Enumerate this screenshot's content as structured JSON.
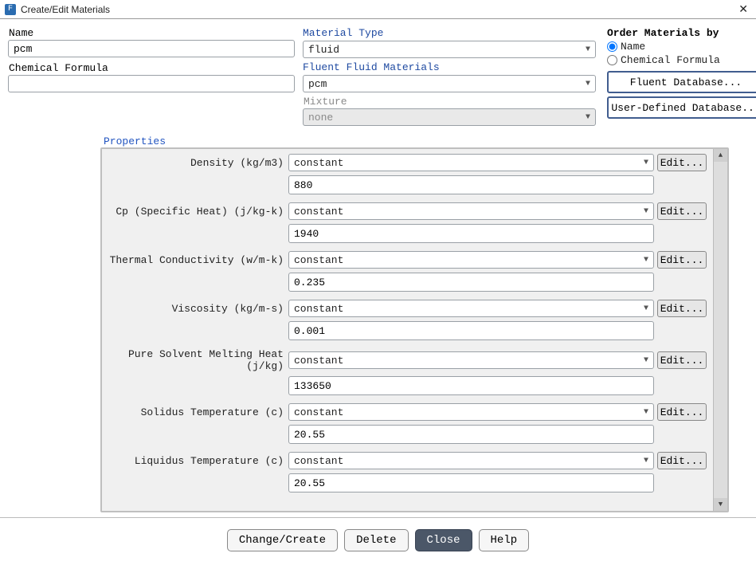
{
  "window": {
    "icon_text": "F",
    "title": "Create/Edit Materials",
    "close": "✕"
  },
  "col1": {
    "name_label": "Name",
    "name_value": "pcm",
    "formula_label": "Chemical Formula",
    "formula_value": ""
  },
  "col2": {
    "type_label": "Material Type",
    "type_value": "fluid",
    "ffm_label": "Fluent Fluid Materials",
    "ffm_value": "pcm",
    "mix_label": "Mixture",
    "mix_value": "none"
  },
  "col3": {
    "order_label": "Order Materials by",
    "radio_name": "Name",
    "radio_formula": "Chemical Formula",
    "btn_fluent_db": "Fluent Database...",
    "btn_user_db": "User-Defined Database..."
  },
  "properties_heading": "Properties",
  "props": [
    {
      "label": "Density (kg/m3)",
      "method": "constant",
      "value": "880"
    },
    {
      "label": "Cp (Specific Heat) (j/kg-k)",
      "method": "constant",
      "value": "1940"
    },
    {
      "label": "Thermal Conductivity (w/m-k)",
      "method": "constant",
      "value": "0.235"
    },
    {
      "label": "Viscosity (kg/m-s)",
      "method": "constant",
      "value": "0.001"
    },
    {
      "label": "Pure Solvent Melting Heat (j/kg)",
      "method": "constant",
      "value": "133650"
    },
    {
      "label": "Solidus Temperature (c)",
      "method": "constant",
      "value": "20.55"
    },
    {
      "label": "Liquidus Temperature (c)",
      "method": "constant",
      "value": "20.55"
    }
  ],
  "edit_btn": "Edit...",
  "buttons": {
    "change_create": "Change/Create",
    "delete": "Delete",
    "close": "Close",
    "help": "Help"
  }
}
